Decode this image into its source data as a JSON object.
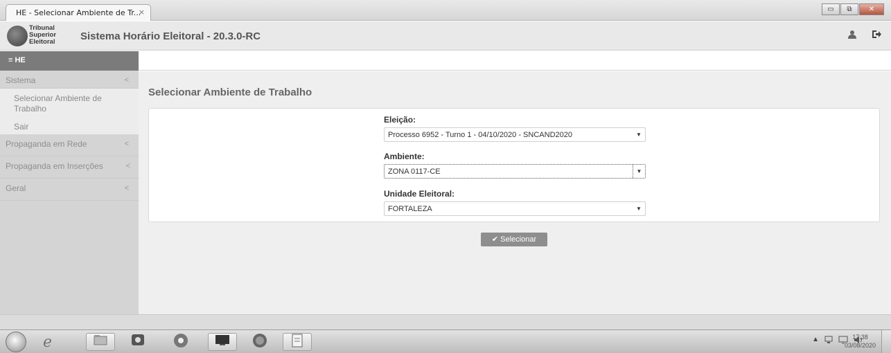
{
  "browser": {
    "tab_title": "HE - Selecionar Ambiente de Tr...",
    "tab_close": "×",
    "minimize": "▭",
    "maximize": "⧉",
    "close": "✕"
  },
  "header": {
    "logo_line1": "Tribunal",
    "logo_line2": "Superior",
    "logo_line3": "Eleitoral",
    "title": "Sistema Horário Eleitoral - 20.3.0-RC",
    "user_icon": "user-icon",
    "logout_icon": "logout-icon"
  },
  "sidebar": {
    "top_label": "≡ HE",
    "sections": [
      {
        "label": "Sistema",
        "chevron": "<"
      },
      {
        "label": "Propaganda em Rede",
        "chevron": "<"
      },
      {
        "label": "Propaganda em Inserções",
        "chevron": "<"
      },
      {
        "label": "Geral",
        "chevron": "<"
      }
    ],
    "sistema_items": [
      {
        "label": "Selecionar Ambiente de Trabalho"
      },
      {
        "label": "Sair"
      }
    ]
  },
  "main": {
    "page_title": "Selecionar Ambiente de Trabalho",
    "fields": [
      {
        "label": "Eleição:",
        "value": "Processo 6952 - Turno 1 - 04/10/2020 - SNCAND2020"
      },
      {
        "label": "Ambiente:",
        "value": "ZONA 0117-CE"
      },
      {
        "label": "Unidade Eleitoral:",
        "value": "FORTALEZA"
      }
    ],
    "caret": "▼",
    "select_button": "✔ Selecionar"
  },
  "taskbar": {
    "tray_arrow": "▲",
    "clock_time": "17:38",
    "clock_date": "03/08/2020"
  },
  "colors": {
    "sidebar_bg": "#d4d4d4",
    "sidebar_header_bg": "#7b7b7b",
    "main_bg": "#efefef",
    "button_bg": "#8e8e8e"
  }
}
